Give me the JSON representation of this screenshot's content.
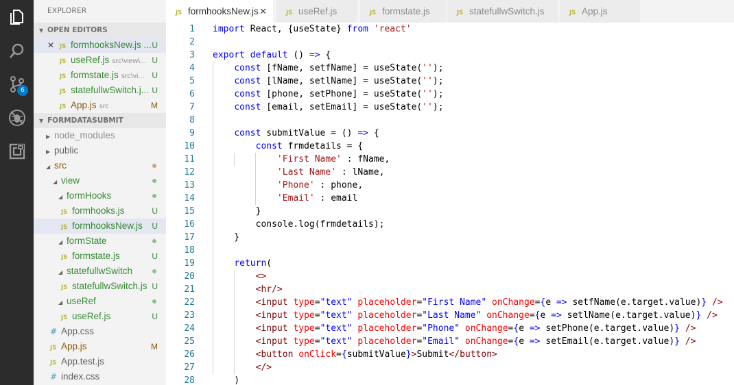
{
  "activity_bar": {
    "icons": [
      "explorer-icon",
      "search-icon",
      "source-control-icon",
      "debug-icon",
      "extensions-icon"
    ],
    "source_control_badge": "6"
  },
  "sidebar": {
    "title": "EXPLORER",
    "open_editors_label": "OPEN EDITORS",
    "open_editors": [
      {
        "name": "formhooksNew.js ...",
        "desc": "",
        "status": "U",
        "close": "✕"
      },
      {
        "name": "useRef.js",
        "desc": "src\\view\\...",
        "status": "U"
      },
      {
        "name": "formstate.js",
        "desc": "src\\vi...",
        "status": "U"
      },
      {
        "name": "statefullwSwitch.j...",
        "desc": "",
        "status": "U"
      },
      {
        "name": "App.js",
        "desc": "src",
        "status": "M"
      }
    ],
    "project_label": "FORMDATASUBMIT",
    "tree": [
      {
        "name": "node_modules",
        "kind": "folder-closed",
        "depth": 0
      },
      {
        "name": "public",
        "kind": "folder-closed",
        "depth": 0
      },
      {
        "name": "src",
        "kind": "folder-open",
        "depth": 0
      },
      {
        "name": "view",
        "kind": "folder-open",
        "depth": 1
      },
      {
        "name": "formHooks",
        "kind": "folder-open",
        "depth": 2
      },
      {
        "name": "formhooks.js",
        "kind": "js",
        "depth": 3,
        "status": "U"
      },
      {
        "name": "formhooksNew.js",
        "kind": "js",
        "depth": 3,
        "status": "U"
      },
      {
        "name": "formState",
        "kind": "folder-open",
        "depth": 2
      },
      {
        "name": "formstate.js",
        "kind": "js",
        "depth": 3,
        "status": "U"
      },
      {
        "name": "statefullwSwitch",
        "kind": "folder-open",
        "depth": 2
      },
      {
        "name": "statefullwSwitch.js",
        "kind": "js",
        "depth": 3,
        "status": "U"
      },
      {
        "name": "useRef",
        "kind": "folder-open",
        "depth": 2
      },
      {
        "name": "useRef.js",
        "kind": "js",
        "depth": 3,
        "status": "U"
      },
      {
        "name": "App.css",
        "kind": "css",
        "depth": 1
      },
      {
        "name": "App.js",
        "kind": "js",
        "depth": 1,
        "status": "M"
      },
      {
        "name": "App.test.js",
        "kind": "js",
        "depth": 1
      },
      {
        "name": "index.css",
        "kind": "css",
        "depth": 1
      }
    ]
  },
  "tabs": [
    {
      "label": "formhooksNew.js",
      "close": "✕"
    },
    {
      "label": "useRef.js"
    },
    {
      "label": "formstate.js"
    },
    {
      "label": "statefullwSwitch.js"
    },
    {
      "label": "App.js"
    }
  ],
  "file_icon_label": "JS",
  "css_icon_label": "#",
  "editor": {
    "line_numbers": [
      "1",
      "2",
      "3",
      "4",
      "5",
      "6",
      "7",
      "8",
      "9",
      "10",
      "11",
      "12",
      "13",
      "14",
      "15",
      "16",
      "17",
      "18",
      "19",
      "20",
      "21",
      "22",
      "23",
      "24",
      "25",
      "26",
      "27",
      "28"
    ],
    "code_lines": [
      [
        [
          "k",
          "import"
        ],
        [
          "p",
          " React, {useState} "
        ],
        [
          "k",
          "from"
        ],
        [
          "p",
          " "
        ],
        [
          "s",
          "'react'"
        ]
      ],
      [],
      [
        [
          "k",
          "export default"
        ],
        [
          "p",
          " () "
        ],
        [
          "k",
          "=>"
        ],
        [
          "p",
          " {"
        ]
      ],
      [
        [
          "p",
          "    "
        ],
        [
          "k",
          "const"
        ],
        [
          "p",
          " [fName, setfName] = useState("
        ],
        [
          "s",
          "''"
        ],
        [
          "p",
          ");"
        ]
      ],
      [
        [
          "p",
          "    "
        ],
        [
          "k",
          "const"
        ],
        [
          "p",
          " [lName, setlName] = useState("
        ],
        [
          "s",
          "''"
        ],
        [
          "p",
          ");"
        ]
      ],
      [
        [
          "p",
          "    "
        ],
        [
          "k",
          "const"
        ],
        [
          "p",
          " [phone, setPhone] = useState("
        ],
        [
          "s",
          "''"
        ],
        [
          "p",
          ");"
        ]
      ],
      [
        [
          "p",
          "    "
        ],
        [
          "k",
          "const"
        ],
        [
          "p",
          " [email, setEmail] = useState("
        ],
        [
          "s",
          "''"
        ],
        [
          "p",
          ");"
        ]
      ],
      [],
      [
        [
          "p",
          "    "
        ],
        [
          "k",
          "const"
        ],
        [
          "p",
          " submitValue = () "
        ],
        [
          "k",
          "=>"
        ],
        [
          "p",
          " {"
        ]
      ],
      [
        [
          "p",
          "        "
        ],
        [
          "k",
          "const"
        ],
        [
          "p",
          " frmdetails = {"
        ]
      ],
      [
        [
          "p",
          "            "
        ],
        [
          "s",
          "'First Name'"
        ],
        [
          "p",
          " : fName,"
        ]
      ],
      [
        [
          "p",
          "            "
        ],
        [
          "s",
          "'Last Name'"
        ],
        [
          "p",
          " : lName,"
        ]
      ],
      [
        [
          "p",
          "            "
        ],
        [
          "s",
          "'Phone'"
        ],
        [
          "p",
          " : phone,"
        ]
      ],
      [
        [
          "p",
          "            "
        ],
        [
          "s",
          "'Email'"
        ],
        [
          "p",
          " : email"
        ]
      ],
      [
        [
          "p",
          "        }"
        ]
      ],
      [
        [
          "p",
          "        console.log(frmdetails);"
        ]
      ],
      [
        [
          "p",
          "    }"
        ]
      ],
      [],
      [
        [
          "p",
          "    "
        ],
        [
          "k",
          "return"
        ],
        [
          "p",
          "("
        ]
      ],
      [
        [
          "p",
          "        "
        ],
        [
          "t",
          "<>"
        ]
      ],
      [
        [
          "p",
          "        "
        ],
        [
          "t",
          "<hr/>"
        ]
      ],
      [
        [
          "p",
          "        "
        ],
        [
          "t",
          "<input"
        ],
        [
          "p",
          " "
        ],
        [
          "a",
          "type"
        ],
        [
          "p",
          "="
        ],
        [
          "av",
          "\"text\""
        ],
        [
          "p",
          " "
        ],
        [
          "a",
          "placeholder"
        ],
        [
          "p",
          "="
        ],
        [
          "av",
          "\"First Name\""
        ],
        [
          "p",
          " "
        ],
        [
          "a",
          "onChange"
        ],
        [
          "p",
          "="
        ],
        [
          "k",
          "{"
        ],
        [
          "p",
          "e "
        ],
        [
          "k",
          "=>"
        ],
        [
          "p",
          " setfName(e.target.value)"
        ],
        [
          "k",
          "}"
        ],
        [
          "p",
          " "
        ],
        [
          "t",
          "/>"
        ]
      ],
      [
        [
          "p",
          "        "
        ],
        [
          "t",
          "<input"
        ],
        [
          "p",
          " "
        ],
        [
          "a",
          "type"
        ],
        [
          "p",
          "="
        ],
        [
          "av",
          "\"text\""
        ],
        [
          "p",
          " "
        ],
        [
          "a",
          "placeholder"
        ],
        [
          "p",
          "="
        ],
        [
          "av",
          "\"Last Name\""
        ],
        [
          "p",
          " "
        ],
        [
          "a",
          "onChange"
        ],
        [
          "p",
          "="
        ],
        [
          "k",
          "{"
        ],
        [
          "p",
          "e "
        ],
        [
          "k",
          "=>"
        ],
        [
          "p",
          " setlName(e.target.value)"
        ],
        [
          "k",
          "}"
        ],
        [
          "p",
          " "
        ],
        [
          "t",
          "/>"
        ]
      ],
      [
        [
          "p",
          "        "
        ],
        [
          "t",
          "<input"
        ],
        [
          "p",
          " "
        ],
        [
          "a",
          "type"
        ],
        [
          "p",
          "="
        ],
        [
          "av",
          "\"text\""
        ],
        [
          "p",
          " "
        ],
        [
          "a",
          "placeholder"
        ],
        [
          "p",
          "="
        ],
        [
          "av",
          "\"Phone\""
        ],
        [
          "p",
          " "
        ],
        [
          "a",
          "onChange"
        ],
        [
          "p",
          "="
        ],
        [
          "k",
          "{"
        ],
        [
          "p",
          "e "
        ],
        [
          "k",
          "=>"
        ],
        [
          "p",
          " setPhone(e.target.value)"
        ],
        [
          "k",
          "}"
        ],
        [
          "p",
          " "
        ],
        [
          "t",
          "/>"
        ]
      ],
      [
        [
          "p",
          "        "
        ],
        [
          "t",
          "<input"
        ],
        [
          "p",
          " "
        ],
        [
          "a",
          "type"
        ],
        [
          "p",
          "="
        ],
        [
          "av",
          "\"text\""
        ],
        [
          "p",
          " "
        ],
        [
          "a",
          "placeholder"
        ],
        [
          "p",
          "="
        ],
        [
          "av",
          "\"Email\""
        ],
        [
          "p",
          " "
        ],
        [
          "a",
          "onChange"
        ],
        [
          "p",
          "="
        ],
        [
          "k",
          "{"
        ],
        [
          "p",
          "e "
        ],
        [
          "k",
          "=>"
        ],
        [
          "p",
          " setEmail(e.target.value)"
        ],
        [
          "k",
          "}"
        ],
        [
          "p",
          " "
        ],
        [
          "t",
          "/>"
        ]
      ],
      [
        [
          "p",
          "        "
        ],
        [
          "t",
          "<button"
        ],
        [
          "p",
          " "
        ],
        [
          "a",
          "onClick"
        ],
        [
          "p",
          "="
        ],
        [
          "k",
          "{"
        ],
        [
          "p",
          "submitValue"
        ],
        [
          "k",
          "}"
        ],
        [
          "t",
          ">"
        ],
        [
          "p",
          "Submit"
        ],
        [
          "t",
          "</button>"
        ]
      ],
      [
        [
          "p",
          "        "
        ],
        [
          "t",
          "</>"
        ]
      ],
      [
        [
          "p",
          "    )"
        ]
      ]
    ]
  },
  "colors": {
    "activity_bar": "#2c2c2c",
    "sidebar": "#f3f3f3",
    "badge": "#007acc",
    "keyword": "#0000ff",
    "string": "#a31515",
    "tag": "#800000",
    "attribute": "#ff0000",
    "line_number": "#237893",
    "untracked": "#388a34",
    "modified": "#895503"
  }
}
